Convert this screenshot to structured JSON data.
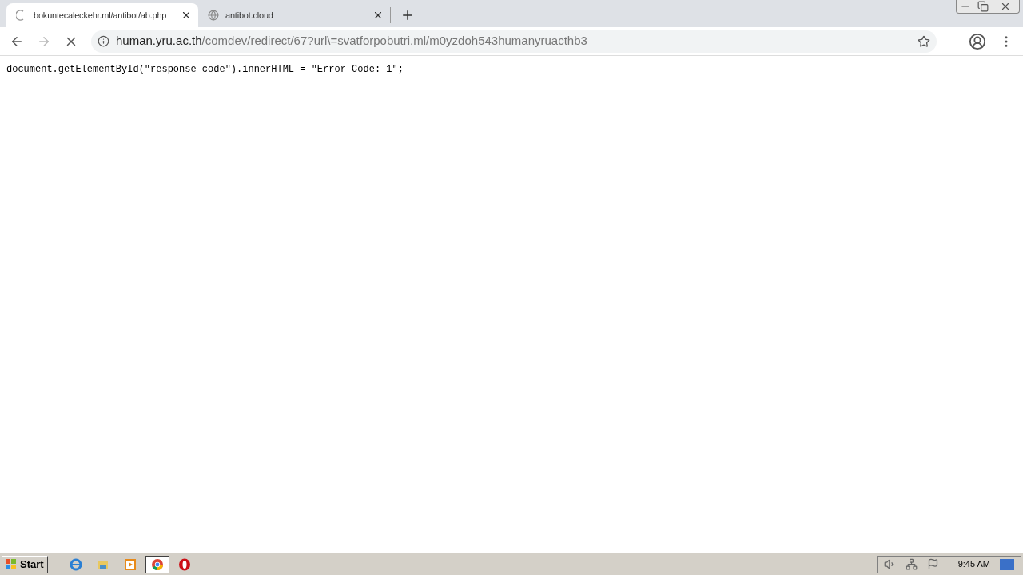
{
  "tabs": [
    {
      "title": "bokuntecaleckehr.ml/antibot/ab.php",
      "selected": true,
      "loading": true
    },
    {
      "title": "antibot.cloud",
      "selected": false,
      "loading": false
    }
  ],
  "address_bar": {
    "host": "human.yru.ac.th",
    "path": "/comdev/redirect/67?url\\=svatforpobutri.ml/m0yzdoh543humanyruacthb3"
  },
  "page_text": "document.getElementById(\"response_code\").innerHTML = \"Error Code: 1\";",
  "taskbar": {
    "start": "Start",
    "apps": [
      {
        "kind": "ie",
        "selected": false
      },
      {
        "kind": "explorer",
        "selected": false
      },
      {
        "kind": "media",
        "selected": false
      },
      {
        "kind": "chrome",
        "selected": true
      },
      {
        "kind": "opera",
        "selected": false
      }
    ],
    "clock": "9:45 AM"
  }
}
